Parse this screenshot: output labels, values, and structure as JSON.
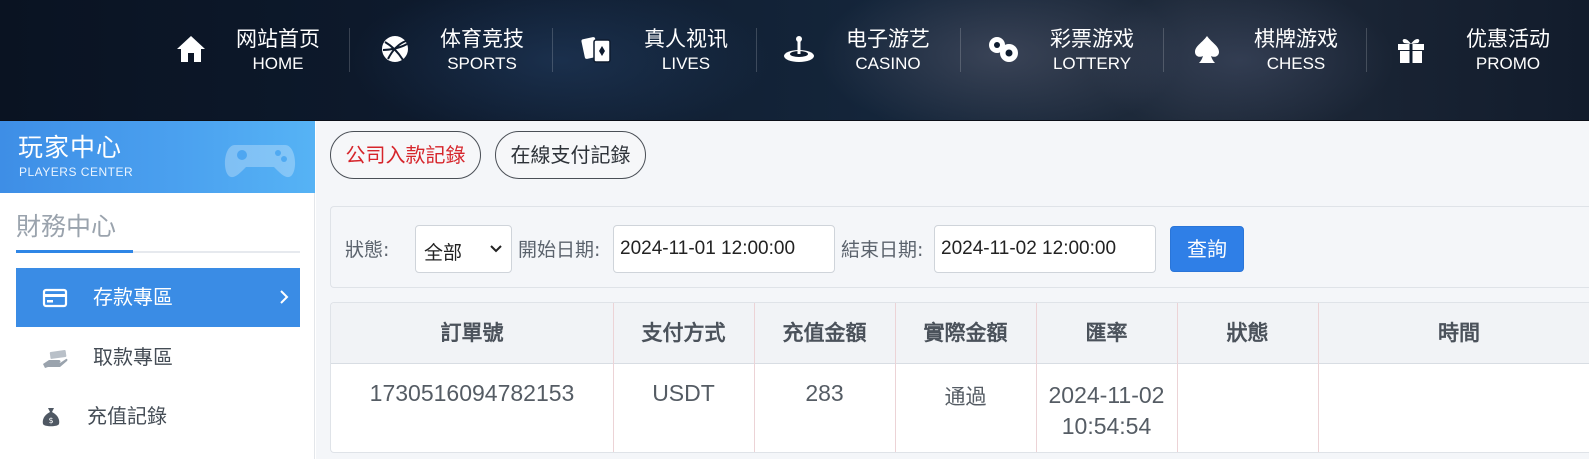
{
  "nav": {
    "items": [
      {
        "cn": "网站首页",
        "en": "HOME",
        "icon": "home-icon"
      },
      {
        "cn": "体育竞技",
        "en": "SPORTS",
        "icon": "ball-icon"
      },
      {
        "cn": "真人视讯",
        "en": "LIVES",
        "icon": "cards-icon"
      },
      {
        "cn": "电子游艺",
        "en": "CASINO",
        "icon": "roulette-icon"
      },
      {
        "cn": "彩票游戏",
        "en": "LOTTERY",
        "icon": "lottery-balls-icon"
      },
      {
        "cn": "棋牌游戏",
        "en": "CHESS",
        "icon": "spade-icon"
      },
      {
        "cn": "优惠活动",
        "en": "PROMO",
        "icon": "gift-icon"
      }
    ]
  },
  "sidebar": {
    "header_title": "玩家中心",
    "header_sub": "PLAYERS CENTER",
    "section_title": "財務中心",
    "items": [
      {
        "label": "存款專區",
        "icon": "card-icon",
        "active": true
      },
      {
        "label": "取款專區",
        "icon": "cash-hand-icon",
        "active": false
      },
      {
        "label": "充值記錄",
        "icon": "money-bag-icon",
        "active": false
      }
    ]
  },
  "tabs": {
    "company_deposit": "公司入款記錄",
    "online_payment": "在線支付記錄"
  },
  "filter": {
    "status_label": "狀態:",
    "status_value": "全部",
    "start_label": "開始日期:",
    "start_value": "2024-11-01 12:00:00",
    "end_label": "結束日期:",
    "end_value": "2024-11-02 12:00:00",
    "query_button": "查詢"
  },
  "table": {
    "headers": [
      "訂單號",
      "支付方式",
      "充值金額",
      "實際金額",
      "匯率",
      "狀態",
      "時間"
    ],
    "rows": [
      {
        "order": "1730516094782153",
        "method": "USDT",
        "amount": "283",
        "actual": "通過",
        "rate_date": "2024-11-02",
        "rate_time": "10:54:54",
        "status": "",
        "time": ""
      }
    ]
  },
  "colors": {
    "accent": "#3a8ce5",
    "button": "#2f7fe7",
    "tab_red": "#d6252b",
    "nav_bg": "#0e1b2e"
  }
}
